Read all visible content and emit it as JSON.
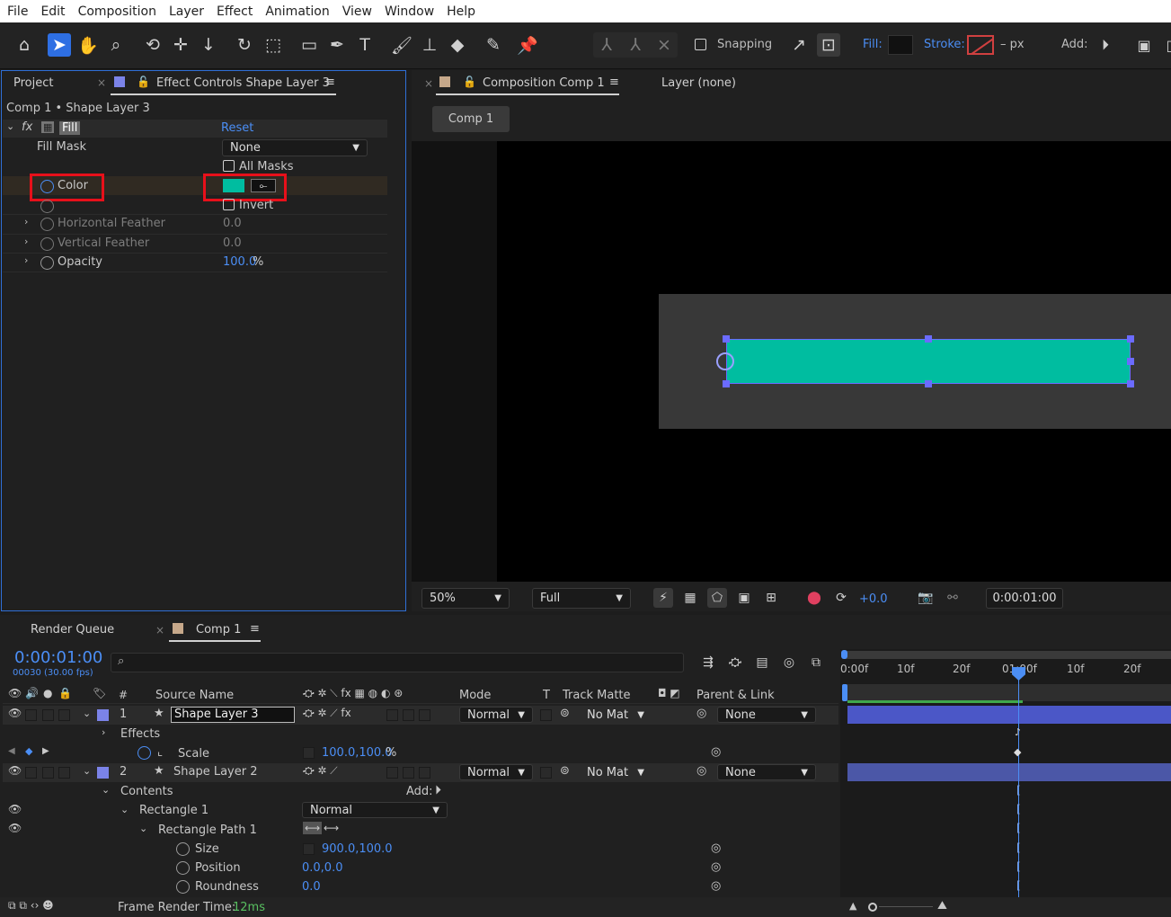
{
  "menu": [
    "File",
    "Edit",
    "Composition",
    "Layer",
    "Effect",
    "Animation",
    "View",
    "Window",
    "Help"
  ],
  "toolbar": {
    "snapping_label": "Snapping",
    "fill_label": "Fill:",
    "stroke_label": "Stroke:",
    "stroke_px": "– px",
    "add_label": "Add:"
  },
  "effect_panel": {
    "tab_project": "Project",
    "tab_effect_controls": "Effect Controls Shape Layer 3",
    "breadcrumb": "Comp 1 • Shape Layer 3",
    "fx_name": "Fill",
    "reset": "Reset",
    "fill_mask_label": "Fill Mask",
    "fill_mask_value": "None",
    "all_masks": "All Masks",
    "color_label": "Color",
    "color_value": "#00bda0",
    "invert": "Invert",
    "h_feather_label": "Horizontal Feather",
    "h_feather_value": "0.0",
    "v_feather_label": "Vertical Feather",
    "v_feather_value": "0.0",
    "opacity_label": "Opacity",
    "opacity_value": "100.0",
    "opacity_unit": "%"
  },
  "comp_panel": {
    "tab_composition": "Composition Comp 1",
    "tab_layer": "Layer (none)",
    "comp_button": "Comp 1",
    "zoom": "50%",
    "resolution": "Full",
    "exposure": "+0.0",
    "timecode": "0:00:01:00",
    "shape_color": "#00bda0"
  },
  "timeline": {
    "tab_render_queue": "Render Queue",
    "tab_comp": "Comp 1",
    "current_time": "0:00:01:00",
    "frames_fps": "00030 (30.00 fps)",
    "search_placeholder": "",
    "col_hash": "#",
    "col_source_name": "Source Name",
    "col_mode": "Mode",
    "col_t": "T",
    "col_track_matte": "Track Matte",
    "col_parent": "Parent & Link",
    "ruler": [
      "0:00f",
      "10f",
      "20f",
      "01:00f",
      "10f",
      "20f"
    ],
    "layer1": {
      "num": "1",
      "name": "Shape Layer 3",
      "mode": "Normal",
      "matte": "No Mat",
      "parent": "None"
    },
    "effects_label": "Effects",
    "scale_label": "Scale",
    "scale_value": "100.0,100.0",
    "scale_unit": "%",
    "layer2": {
      "num": "2",
      "name": "Shape Layer 2",
      "mode": "Normal",
      "matte": "No Mat",
      "parent": "None"
    },
    "contents_label": "Contents",
    "add_label": "Add:",
    "rect1_label": "Rectangle 1",
    "rect1_mode": "Normal",
    "rectpath_label": "Rectangle Path 1",
    "size_label": "Size",
    "size_value": "900.0,100.0",
    "position_label": "Position",
    "position_value": "0.0,0.0",
    "roundness_label": "Roundness",
    "roundness_value": "0.0",
    "frame_render_label": "Frame Render Time:",
    "frame_render_value": "12ms"
  }
}
